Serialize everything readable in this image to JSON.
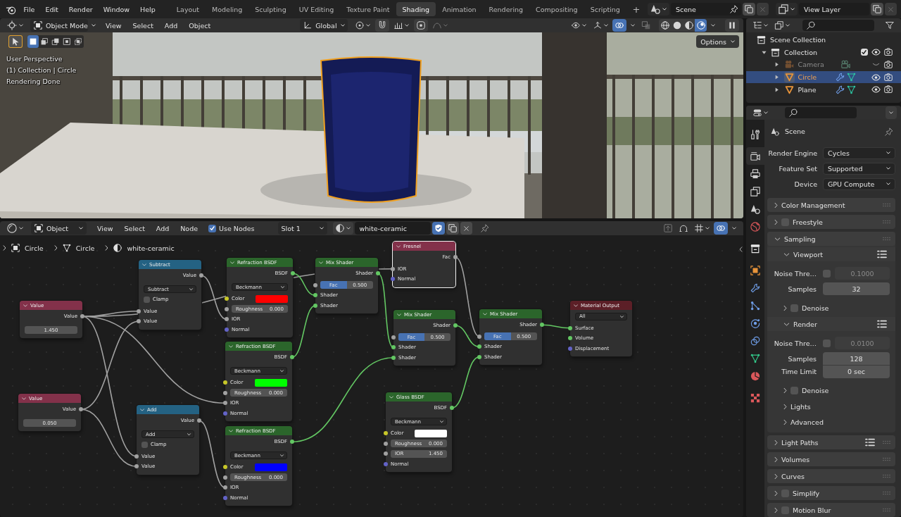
{
  "top_bar": {
    "menus": [
      "File",
      "Edit",
      "Render",
      "Window",
      "Help"
    ],
    "workspaces": [
      {
        "label": "Layout",
        "selected": false
      },
      {
        "label": "Modeling",
        "selected": false
      },
      {
        "label": "Sculpting",
        "selected": false
      },
      {
        "label": "UV Editing",
        "selected": false
      },
      {
        "label": "Texture Paint",
        "selected": false
      },
      {
        "label": "Shading",
        "selected": true
      },
      {
        "label": "Animation",
        "selected": false
      },
      {
        "label": "Rendering",
        "selected": false
      },
      {
        "label": "Compositing",
        "selected": false
      },
      {
        "label": "Scripting",
        "selected": false
      }
    ],
    "add_workspace": "+",
    "scene": "Scene",
    "view_layer": "View Layer"
  },
  "viewport": {
    "mode": "Object Mode",
    "menus": [
      "View",
      "Select",
      "Add",
      "Object"
    ],
    "orientation": "Global",
    "overlays": true,
    "shading": [
      {
        "kind": "wireframe",
        "selected": false
      },
      {
        "kind": "solid",
        "selected": false
      },
      {
        "kind": "material",
        "selected": false
      },
      {
        "kind": "rendered",
        "selected": true
      }
    ],
    "select_modes": [
      {
        "kind": "set",
        "selected": true
      },
      {
        "kind": "extend",
        "selected": false
      },
      {
        "kind": "subtract",
        "selected": false
      },
      {
        "kind": "invert",
        "selected": false
      },
      {
        "kind": "intersect",
        "selected": false
      }
    ],
    "options": "Options",
    "info": [
      "User Perspective",
      "(1) Collection | Circle",
      "Rendering Done"
    ]
  },
  "node_editor": {
    "object": "Object",
    "menus": [
      "View",
      "Select",
      "Add",
      "Node"
    ],
    "use_nodes": {
      "label": "Use Nodes",
      "checked": true
    },
    "slot": "Slot 1",
    "material": "white-ceramic",
    "fake_user": true,
    "overlays": true,
    "breadcrumbs": [
      {
        "kind": "object",
        "label": "Circle"
      },
      {
        "kind": "mesh",
        "label": "Circle"
      },
      {
        "kind": "material",
        "label": "white-ceramic"
      }
    ],
    "nodes": [
      {
        "title": "Value",
        "kind": "input",
        "selected": false,
        "rows": [
          {
            "kind": "output",
            "label": "Value",
            "socket": {
              "color": "#a1a1a1"
            }
          },
          {
            "kind": "field",
            "value": "1.450"
          }
        ]
      },
      {
        "title": "Value",
        "kind": "input",
        "selected": false,
        "rows": [
          {
            "kind": "output",
            "label": "Value",
            "socket": {
              "color": "#a1a1a1"
            }
          },
          {
            "kind": "field",
            "value": "0.050"
          }
        ]
      },
      {
        "title": "Subtract",
        "kind": "converter",
        "selected": false,
        "rows": [
          {
            "kind": "output",
            "label": "Value",
            "socket": {
              "color": "#a1a1a1"
            }
          },
          {
            "kind": "dropdown",
            "value": "Subtract"
          },
          {
            "kind": "checkbox",
            "label": "Clamp",
            "checked": false
          },
          {
            "kind": "input",
            "label": "Value",
            "socket": {
              "color": "#a1a1a1"
            }
          },
          {
            "kind": "input",
            "label": "Value",
            "socket": {
              "color": "#a1a1a1"
            }
          }
        ]
      },
      {
        "title": "Add",
        "kind": "converter",
        "selected": false,
        "rows": [
          {
            "kind": "output",
            "label": "Value",
            "socket": {
              "color": "#a1a1a1"
            }
          },
          {
            "kind": "dropdown",
            "value": "Add"
          },
          {
            "kind": "checkbox",
            "label": "Clamp",
            "checked": false
          },
          {
            "kind": "input",
            "label": "Value",
            "socket": {
              "color": "#a1a1a1"
            }
          },
          {
            "kind": "input",
            "label": "Value",
            "socket": {
              "color": "#a1a1a1"
            }
          }
        ]
      },
      {
        "title": "Refraction BSDF",
        "kind": "shader",
        "selected": false,
        "rows": [
          {
            "kind": "output",
            "label": "BSDF",
            "socket": {
              "color": "#63c763"
            }
          },
          {
            "kind": "dropdown",
            "value": "Beckmann"
          },
          {
            "kind": "color",
            "label": "Color",
            "socket": {
              "color": "#c7c729"
            },
            "color": "#ff0000"
          },
          {
            "kind": "number",
            "label": "Roughness",
            "value": "0.000",
            "socket": {
              "color": "#a1a1a1"
            }
          },
          {
            "kind": "input",
            "label": "IOR",
            "socket": {
              "color": "#a1a1a1"
            }
          },
          {
            "kind": "input",
            "label": "Normal",
            "socket": {
              "color": "#6363c7"
            }
          }
        ]
      },
      {
        "title": "Refraction BSDF",
        "kind": "shader",
        "selected": false,
        "rows": [
          {
            "kind": "output",
            "label": "BSDF",
            "socket": {
              "color": "#63c763"
            }
          },
          {
            "kind": "dropdown",
            "value": "Beckmann"
          },
          {
            "kind": "color",
            "label": "Color",
            "socket": {
              "color": "#c7c729"
            },
            "color": "#00ff00"
          },
          {
            "kind": "number",
            "label": "Roughness",
            "value": "0.000",
            "socket": {
              "color": "#a1a1a1"
            }
          },
          {
            "kind": "input",
            "label": "IOR",
            "socket": {
              "color": "#a1a1a1"
            }
          },
          {
            "kind": "input",
            "label": "Normal",
            "socket": {
              "color": "#6363c7"
            }
          }
        ]
      },
      {
        "title": "Refraction BSDF",
        "kind": "shader",
        "selected": false,
        "rows": [
          {
            "kind": "output",
            "label": "BSDF",
            "socket": {
              "color": "#63c763"
            }
          },
          {
            "kind": "dropdown",
            "value": "Beckmann"
          },
          {
            "kind": "color",
            "label": "Color",
            "socket": {
              "color": "#c7c729"
            },
            "color": "#0000ff"
          },
          {
            "kind": "number",
            "label": "Roughness",
            "value": "0.000",
            "socket": {
              "color": "#a1a1a1"
            }
          },
          {
            "kind": "input",
            "label": "IOR",
            "socket": {
              "color": "#a1a1a1"
            }
          },
          {
            "kind": "input",
            "label": "Normal",
            "socket": {
              "color": "#6363c7"
            }
          }
        ]
      },
      {
        "title": "Mix Shader",
        "kind": "shader",
        "selected": false,
        "rows": [
          {
            "kind": "output",
            "label": "Shader",
            "socket": {
              "color": "#63c763"
            }
          },
          {
            "kind": "factor",
            "label": "Fac",
            "value": "0.500",
            "level": 0.5,
            "socket": {
              "color": "#a1a1a1"
            }
          },
          {
            "kind": "input",
            "label": "Shader",
            "socket": {
              "color": "#63c763"
            }
          },
          {
            "kind": "input",
            "label": "Shader",
            "socket": {
              "color": "#63c763"
            }
          }
        ]
      },
      {
        "title": "Fresnel",
        "kind": "input",
        "selected": true,
        "rows": [
          {
            "kind": "output",
            "label": "Fac",
            "socket": {
              "color": "#a1a1a1"
            }
          },
          {
            "kind": "input",
            "label": "IOR",
            "socket": {
              "color": "#a1a1a1"
            }
          },
          {
            "kind": "input",
            "label": "Normal",
            "socket": {
              "color": "#6363c7"
            }
          }
        ]
      },
      {
        "title": "Mix Shader",
        "kind": "shader",
        "selected": false,
        "rows": [
          {
            "kind": "output",
            "label": "Shader",
            "socket": {
              "color": "#63c763"
            }
          },
          {
            "kind": "factor",
            "label": "Fac",
            "value": "0.500",
            "level": 0.5,
            "socket": {
              "color": "#a1a1a1"
            }
          },
          {
            "kind": "input",
            "label": "Shader",
            "socket": {
              "color": "#63c763"
            }
          },
          {
            "kind": "input",
            "label": "Shader",
            "socket": {
              "color": "#63c763"
            }
          }
        ]
      },
      {
        "title": "Glass BSDF",
        "kind": "shader",
        "selected": false,
        "rows": [
          {
            "kind": "output",
            "label": "BSDF",
            "socket": {
              "color": "#63c763"
            }
          },
          {
            "kind": "dropdown",
            "value": "Beckmann"
          },
          {
            "kind": "color",
            "label": "Color",
            "socket": {
              "color": "#c7c729"
            },
            "color": "#ffffff"
          },
          {
            "kind": "number",
            "label": "Roughness",
            "value": "0.000",
            "socket": {
              "color": "#a1a1a1"
            }
          },
          {
            "kind": "number",
            "label": "IOR",
            "value": "1.450",
            "socket": {
              "color": "#a1a1a1"
            }
          },
          {
            "kind": "input",
            "label": "Normal",
            "socket": {
              "color": "#6363c7"
            }
          }
        ]
      },
      {
        "title": "Mix Shader",
        "kind": "shader",
        "selected": false,
        "rows": [
          {
            "kind": "output",
            "label": "Shader",
            "socket": {
              "color": "#63c763"
            }
          },
          {
            "kind": "factor",
            "label": "Fac",
            "value": "0.500",
            "level": 0.5,
            "socket": {
              "color": "#a1a1a1"
            }
          },
          {
            "kind": "input",
            "label": "Shader",
            "socket": {
              "color": "#63c763"
            }
          },
          {
            "kind": "input",
            "label": "Shader",
            "socket": {
              "color": "#63c763"
            }
          }
        ]
      },
      {
        "title": "Material Output",
        "kind": "output",
        "selected": false,
        "rows": [
          {
            "kind": "dropdown",
            "value": "All"
          },
          {
            "kind": "input",
            "label": "Surface",
            "socket": {
              "color": "#63c763"
            }
          },
          {
            "kind": "input",
            "label": "Volume",
            "socket": {
              "color": "#63c763"
            }
          },
          {
            "kind": "input",
            "label": "Displacement",
            "socket": {
              "color": "#6363c7"
            }
          }
        ]
      }
    ]
  },
  "outliner": {
    "tree": [
      {
        "label": "Scene Collection",
        "kind": "scene_collection",
        "selected": false,
        "children": [
          {
            "label": "Collection",
            "kind": "collection",
            "selected": false,
            "expanded": true,
            "included": true,
            "visible": true,
            "renderable": true,
            "children": [
              {
                "label": "Camera",
                "kind": "camera",
                "selected": false,
                "expanded": false,
                "visible": false,
                "renderable": true,
                "badges": [
                  {
                    "kind": "camera_data"
                  }
                ]
              },
              {
                "label": "Circle",
                "kind": "mesh",
                "selected": true,
                "expanded": false,
                "visible": true,
                "renderable": true,
                "badges": [
                  {
                    "kind": "modifiers"
                  },
                  {
                    "kind": "mesh_data"
                  }
                ]
              },
              {
                "label": "Plane",
                "kind": "mesh",
                "selected": false,
                "expanded": false,
                "visible": true,
                "renderable": true,
                "badges": [
                  {
                    "kind": "modifiers"
                  },
                  {
                    "kind": "mesh_data"
                  }
                ]
              }
            ]
          }
        ]
      }
    ]
  },
  "properties": {
    "tabs": [
      {
        "kind": "tool",
        "selected": false
      },
      {
        "kind": "render",
        "selected": true
      },
      {
        "kind": "output",
        "selected": false
      },
      {
        "kind": "view_layer",
        "selected": false
      },
      {
        "kind": "scene",
        "selected": false
      },
      {
        "kind": "world",
        "selected": false
      },
      {
        "kind": "collection",
        "selected": false
      },
      {
        "kind": "object",
        "selected": false
      },
      {
        "kind": "modifiers",
        "selected": false
      },
      {
        "kind": "particles",
        "selected": false
      },
      {
        "kind": "physics",
        "selected": false
      },
      {
        "kind": "constraints",
        "selected": false
      },
      {
        "kind": "data",
        "selected": false
      },
      {
        "kind": "material",
        "selected": false
      },
      {
        "kind": "texture",
        "selected": false
      }
    ],
    "context": "Scene",
    "settings": [
      {
        "label": "Render Engine",
        "value": "Cycles"
      },
      {
        "label": "Feature Set",
        "value": "Supported"
      },
      {
        "label": "Device",
        "value": "GPU Compute"
      }
    ],
    "panels": [
      {
        "title": "Color Management",
        "expanded": false
      },
      {
        "title": "Freestyle",
        "expanded": false,
        "checked": false
      },
      {
        "title": "Sampling",
        "expanded": true,
        "subpanels": [
          {
            "title": "Viewport",
            "expanded": true,
            "presets": true,
            "rows": [
              {
                "kind": "toggle_number",
                "label": "Noise Thre…",
                "checked": false,
                "value": "0.1000",
                "disabled": true
              },
              {
                "kind": "number",
                "label": "Samples",
                "value": "32"
              }
            ],
            "subpanels": [
              {
                "title": "Denoise",
                "expanded": false,
                "checked": false
              }
            ]
          },
          {
            "title": "Render",
            "expanded": true,
            "presets": true,
            "rows": [
              {
                "kind": "toggle_number",
                "label": "Noise Thre…",
                "checked": false,
                "value": "0.0100",
                "disabled": true
              },
              {
                "kind": "number",
                "label": "Samples",
                "value": "128"
              },
              {
                "kind": "number",
                "label": "Time Limit",
                "value": "0 sec"
              }
            ],
            "subpanels": [
              {
                "title": "Denoise",
                "expanded": false,
                "checked": false
              }
            ]
          },
          {
            "title": "Lights",
            "expanded": false
          },
          {
            "title": "Advanced",
            "expanded": false
          }
        ]
      },
      {
        "title": "Light Paths",
        "expanded": false,
        "presets": true
      },
      {
        "title": "Volumes",
        "expanded": false
      },
      {
        "title": "Curves",
        "expanded": false
      },
      {
        "title": "Simplify",
        "expanded": false,
        "checked": false
      },
      {
        "title": "Motion Blur",
        "expanded": false,
        "checked": false
      }
    ]
  }
}
